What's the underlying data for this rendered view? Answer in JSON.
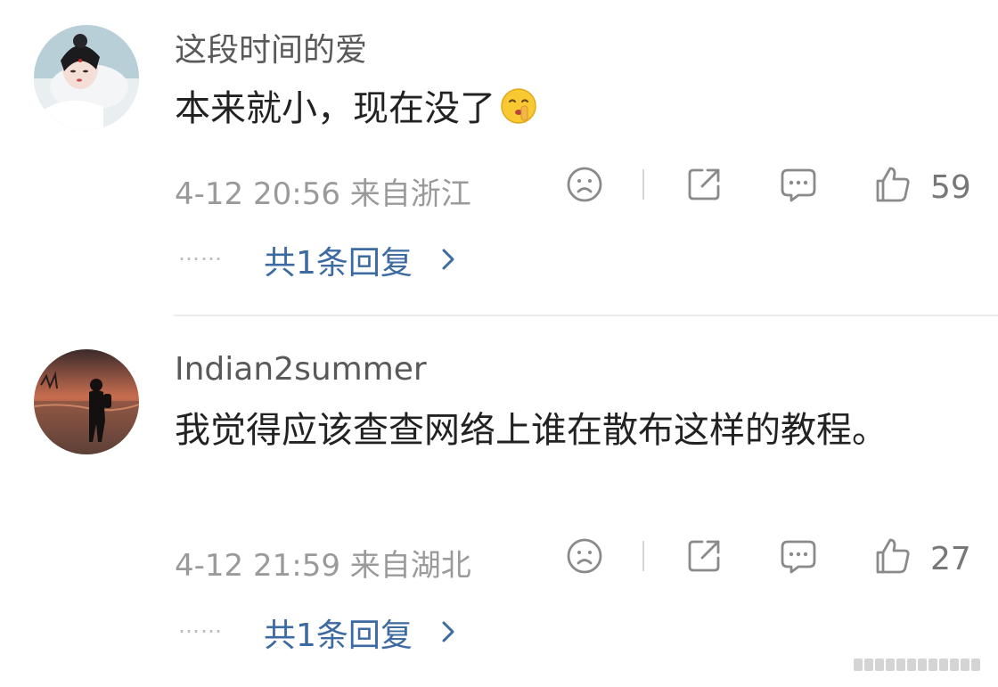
{
  "comments": [
    {
      "username": "这段时间的爱",
      "content": "本来就小，现在没了",
      "emoji_icon": "shushing-face-emoji",
      "date": "4-12 20:56",
      "location": "来自浙江",
      "likes": "59",
      "reply_link": "共1条回复",
      "dots": "……"
    },
    {
      "username": "Indian2summer",
      "content": "我觉得应该查查网络上谁在散布这样的教程。",
      "date": "4-12 21:59",
      "location": "来自湖北",
      "likes": "27",
      "reply_link": "共1条回复",
      "dots": "……"
    }
  ],
  "icons": [
    "frown-face-icon",
    "share-icon",
    "comment-bubble-icon",
    "thumbs-up-icon",
    "chevron-right-icon"
  ],
  "colors": {
    "username": "#595959",
    "text": "#222222",
    "meta": "#9a9a9a",
    "link": "#3c6aa1",
    "icon": "#8a8a8a"
  }
}
